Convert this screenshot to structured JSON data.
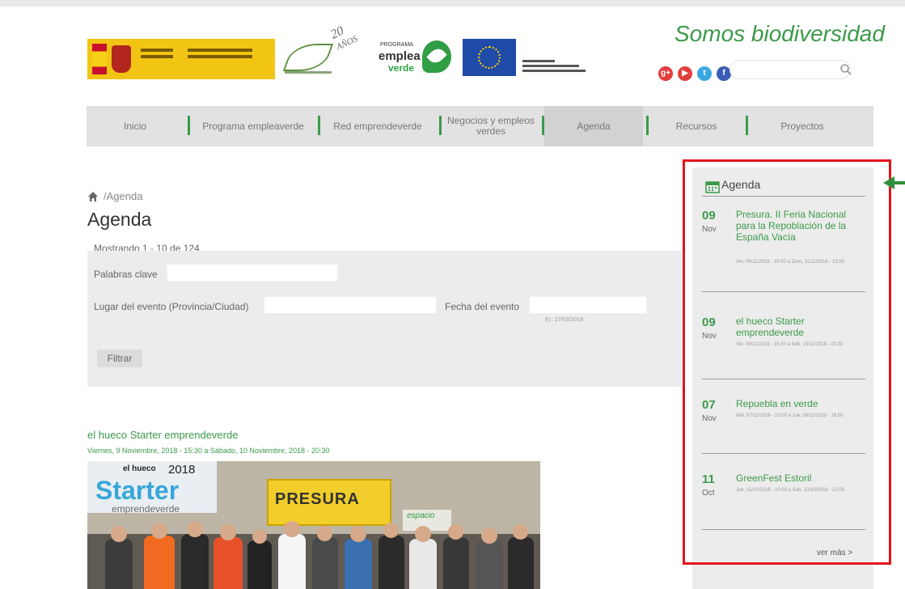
{
  "header": {
    "tagline": "Somos biodiversidad",
    "logo_20": "20",
    "logo_anios": "AÑOS",
    "emplea_small": "PROGRAMA",
    "emplea_big": "emplea",
    "emplea_verde": "verde",
    "search": {
      "value": "",
      "placeholder": ""
    }
  },
  "social": [
    {
      "icon": "google-plus-icon",
      "glyph": "g+",
      "color": "#e23d3d"
    },
    {
      "icon": "youtube-icon",
      "glyph": "▶",
      "color": "#e23d3d"
    },
    {
      "icon": "twitter-icon",
      "glyph": "t",
      "color": "#3aa7e0"
    },
    {
      "icon": "facebook-icon",
      "glyph": "f",
      "color": "#3b5bb5"
    }
  ],
  "nav": {
    "items": [
      {
        "label": "Inicio"
      },
      {
        "label": "Programa empleaverde"
      },
      {
        "label": "Red emprendeverde"
      },
      {
        "label": "Negocios y empleos verdes"
      },
      {
        "label": "Agenda",
        "active": true
      },
      {
        "label": "Recursos"
      },
      {
        "label": "Proyectos"
      }
    ]
  },
  "breadcrumb": {
    "text": "/Agenda"
  },
  "page": {
    "title": "Agenda",
    "showing": "Mostrando 1 - 10 de 124"
  },
  "filters": {
    "keywords_label": "Palabras clave",
    "keywords_value": "",
    "place_label": "Lugar del evento (Provincia/Ciudad)",
    "place_value": "",
    "date_label": "Fecha del evento",
    "date_value": "",
    "date_hint": "Ej.: 27/03/2018",
    "submit_label": "Filtrar"
  },
  "event": {
    "title": "el hueco Starter emprendeverde",
    "date": "Viernes, 9 Noviembre, 2018 - 15:30 a Sábado, 10 Noviembre, 2018 - 20:30",
    "photo": {
      "brand": "el hueco",
      "year": "2018",
      "starter": "Starter",
      "emprende": "emprendeverde",
      "banner": "PRESURA",
      "sign": "espacio"
    }
  },
  "sidebar": {
    "title": "Agenda",
    "events": [
      {
        "day": "09",
        "month": "Nov",
        "title": "Presura. II Feria Nacional para la Repoblación de la España Vacía",
        "time": "Vie, 09/11/2018 - 10:00 a Dom, 11/11/2018 - 15:00"
      },
      {
        "day": "09",
        "month": "Nov",
        "title": "el hueco Starter emprendeverde",
        "time": "Vie, 09/11/2018 - 15:30 a Sáb, 10/11/2018 - 20:30"
      },
      {
        "day": "07",
        "month": "Nov",
        "title": "Repuebla en verde",
        "time": "Mié, 07/11/2018 - 10:00 a Jue, 08/11/2018 - 18:00"
      },
      {
        "day": "11",
        "month": "Oct",
        "title": "GreenFest Estoril",
        "time": "Jue, 11/10/2018 - 10:00 a Sáb, 13/10/2018 - 22:00"
      }
    ],
    "see_more": "ver más >"
  },
  "colors": {
    "accent": "#3c9a4a",
    "highlight": "#e2141b",
    "nav_bg": "#e2e2e2",
    "panel_bg": "#ececec"
  }
}
